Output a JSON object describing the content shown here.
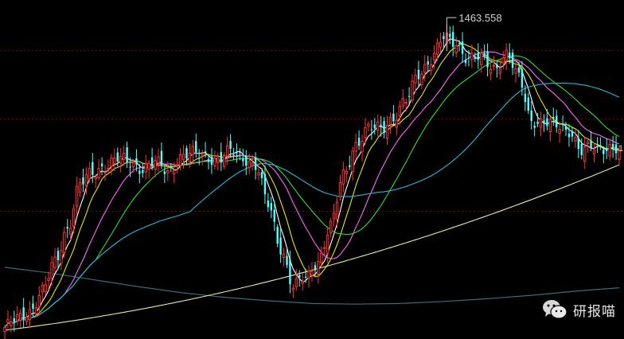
{
  "chart_data": {
    "type": "candlestick",
    "title": "",
    "xlabel": "",
    "ylabel": "",
    "grid": true,
    "ylim": [
      1000,
      1480
    ],
    "annotations": [
      {
        "text": "1463.558",
        "kind": "max-price-marker",
        "value": 1463.558
      }
    ],
    "edge_label": "1",
    "colors": {
      "background": "#000000",
      "up": "#ff3232",
      "down": "#54fcfc",
      "grid": "#8a0000",
      "ma5": "#ffffff",
      "ma10": "#e8e800",
      "ma20": "#ff66ff",
      "ma30": "#33dd33",
      "ma60": "#22bbdd",
      "ma120": "#e8e8a0",
      "ma250": "#2f6f7f"
    },
    "series": [
      {
        "role": "ma5",
        "period": 5
      },
      {
        "role": "ma10",
        "period": 10
      },
      {
        "role": "ma20",
        "period": 20
      },
      {
        "role": "ma30",
        "period": 30
      },
      {
        "role": "ma60",
        "period": 60
      },
      {
        "role": "ma120",
        "period": 120
      }
    ],
    "long_average": {
      "role": "ma250",
      "values": [
        1098,
        1090,
        1080,
        1070,
        1061,
        1054,
        1049,
        1045,
        1044,
        1045,
        1048,
        1052,
        1057,
        1063,
        1068
      ]
    },
    "closes": [
      1010,
      1021,
      1035,
      1063,
      1104,
      1156,
      1219,
      1235,
      1248,
      1256,
      1251,
      1244,
      1250,
      1238,
      1260,
      1263,
      1262,
      1255,
      1266,
      1260,
      1246,
      1189,
      1128,
      1070,
      1081,
      1109,
      1157,
      1232,
      1279,
      1299,
      1302,
      1318,
      1340,
      1382,
      1404,
      1432,
      1427,
      1404,
      1402,
      1391,
      1409,
      1374,
      1315,
      1308,
      1305,
      1300,
      1266,
      1274,
      1275,
      1269
    ],
    "ma120_start": 1006,
    "ma120_end": 1248
  },
  "watermark": {
    "icon": "wechat-icon",
    "text": "研报喵"
  }
}
